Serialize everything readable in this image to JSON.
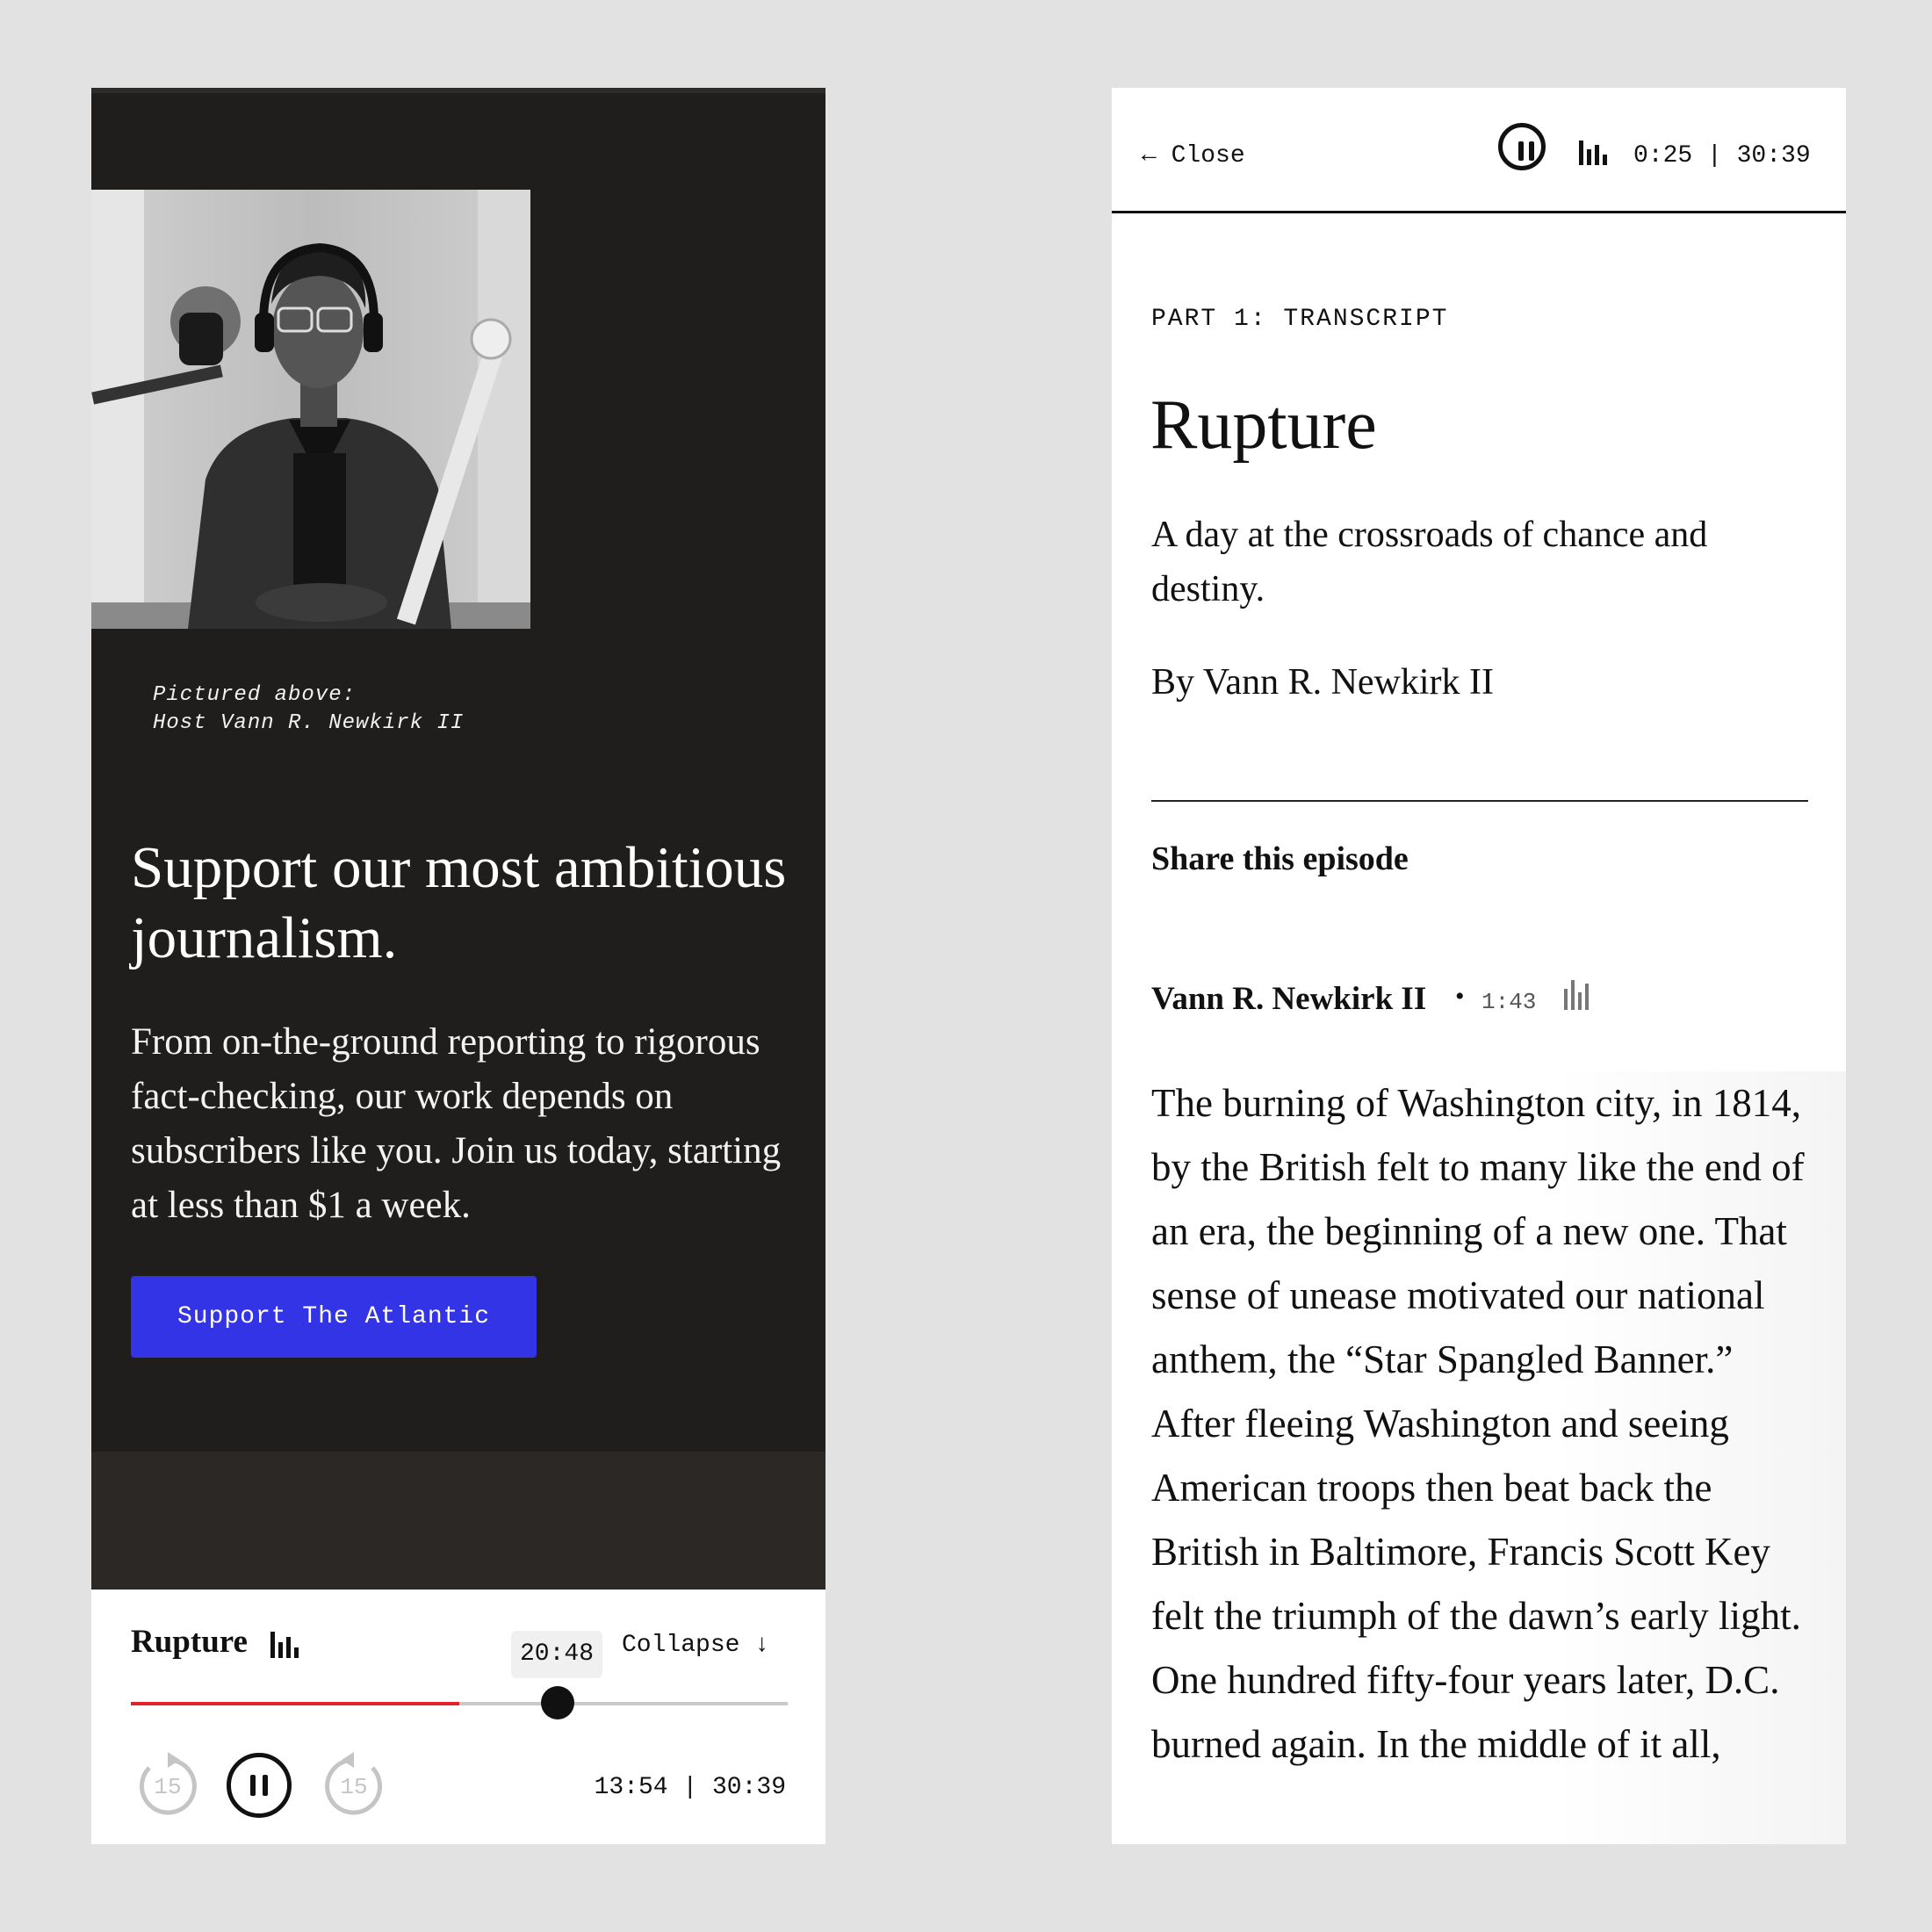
{
  "left_screen": {
    "photo_caption": {
      "line1": "Pictured above:",
      "line2": "Host Vann R. Newkirk II"
    },
    "promo": {
      "title": "Support our most ambitious journalism.",
      "body": "From on-the-ground reporting to rigorous fact-checking, our work depends on subscribers like you. Join us today, starting at less than $1 a week.",
      "button_label": "Support The Atlantic"
    },
    "mini_player": {
      "episode_title": "Rupture",
      "scrub_time": "20:48",
      "collapse_label": "Collapse ↓",
      "skip_back_seconds": "15",
      "skip_forward_seconds": "15",
      "time_display": "13:54 | 30:39",
      "progress_fraction": 0.5,
      "scrub_fraction": 0.65
    }
  },
  "right_screen": {
    "header": {
      "close_label": "← Close",
      "time_display": "0:25 | 30:39"
    },
    "part_label": "PART 1: TRANSCRIPT",
    "title": "Rupture",
    "dek": "A day at the crossroads of chance and destiny.",
    "byline": "By Vann R. Newkirk II",
    "share_label": "Share this episode",
    "speaker": {
      "name": "Vann R. Newkirk II",
      "separator": "•",
      "timestamp": "1:43"
    },
    "transcript": "The burning of Washington city, in 1814, by the British felt to many like the end of an era, the beginning of a new one. That sense of unease motivated our national anthem, the “Star Spangled Banner.” After fleeing Washington and seeing American troops then beat back the British in Baltimore, Francis Scott Key felt the triumph of the dawn’s early light. One hundred fifty-four years later, D.C. burned again. In the middle of it all,"
  },
  "colors": {
    "dark_bg": "#1f1e1d",
    "accent_blue": "#3334e6",
    "progress_red": "#e2232a",
    "page_bg": "#e2e2e2"
  },
  "icons": [
    "audio-bars-icon",
    "pause-icon",
    "skip-back-15-icon",
    "skip-forward-15-icon",
    "arrow-left-icon",
    "arrow-down-icon"
  ]
}
